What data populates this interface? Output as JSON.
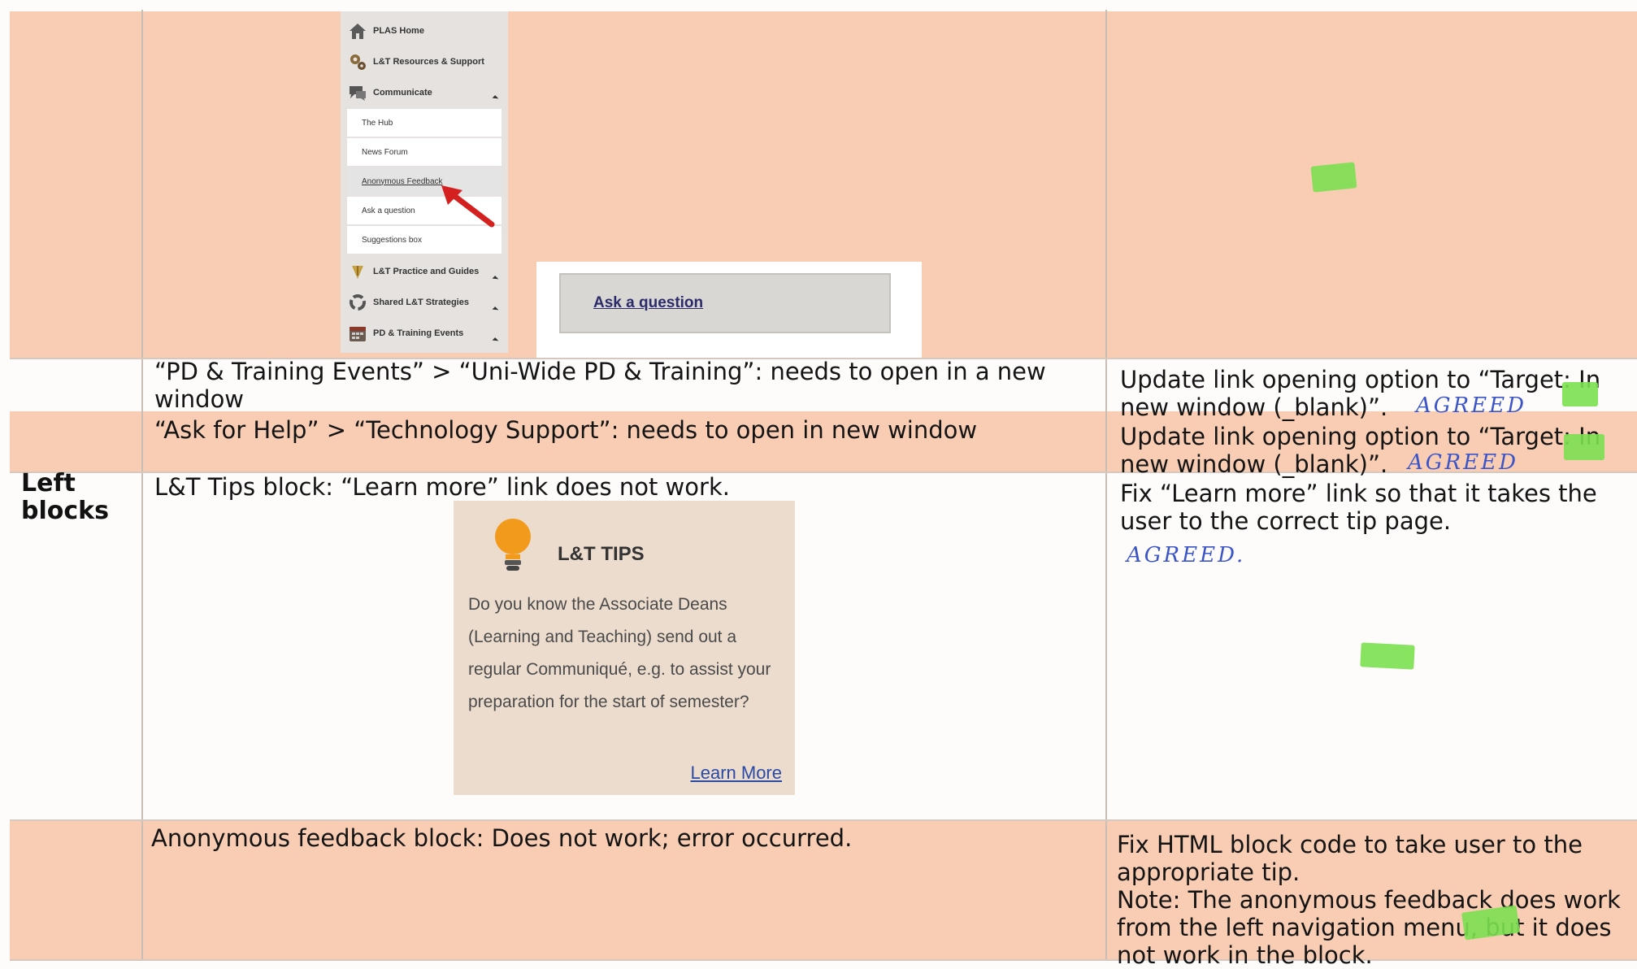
{
  "nav_screenshot": {
    "items": [
      {
        "label": "PLAS Home",
        "icon": "house-icon"
      },
      {
        "label": "L&T Resources & Support",
        "icon": "cog-icon"
      },
      {
        "label": "Communicate",
        "icon": "speech-icon"
      }
    ],
    "sub_items": [
      "The Hub",
      "News Forum",
      "Anonymous Feedback",
      "Ask a question",
      "Suggestions box"
    ],
    "lower_items": [
      {
        "label": "L&T Practice and Guides",
        "icon": "pen-icon"
      },
      {
        "label": "Shared L&T Strategies",
        "icon": "recycle-icon"
      },
      {
        "label": "PD & Training Events",
        "icon": "calendar-icon"
      }
    ]
  },
  "ask_screenshot": {
    "link": "Ask a question"
  },
  "rows": {
    "pd_issue": "“PD & Training Events” > “Uni-Wide PD & Training”: needs to open in a new window",
    "pd_fix": "Update link opening option to “Target: In new window (_blank)”.",
    "ask_issue": "“Ask for Help” > “Technology Support”: needs to open in new window",
    "ask_fix": "Update link opening option to “Target: In new window (_blank)”.",
    "left_blocks_header": "Left blocks",
    "tips_issue": "L&T Tips block: “Learn more” link does not work.",
    "tips_fix": "Fix “Learn more” link so that it takes the user to the correct tip page.",
    "anon_issue": "Anonymous feedback block: Does not work; error occurred.",
    "anon_fix": "Fix HTML block code to take user to the appropriate tip.",
    "anon_note": "Note: The anonymous feedback does work from the left navigation menu, but it does not work in the block."
  },
  "handwritten": {
    "agreed1": "AGREED",
    "agreed2": "AGREED",
    "agreed3": "AGREED."
  },
  "tips_card": {
    "title": "L&T TIPS",
    "body": "Do you know the Associate Deans (Learning and Teaching) send out a regular Communiqué, e.g. to assist your preparation for the start of semester?",
    "link": "Learn More"
  },
  "colors": {
    "band": "#f8cdb4",
    "highlight": "#7be050",
    "ink": "#3b55c8"
  }
}
